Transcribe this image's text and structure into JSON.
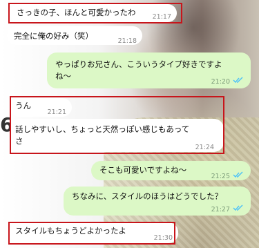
{
  "messages": [
    {
      "side": "left",
      "text": "さっきの子、ほんと可愛かったわ",
      "time": "21:17"
    },
    {
      "side": "left",
      "text": "完全に俺の好み（笑）",
      "time": "21:18"
    },
    {
      "side": "right",
      "lines": [
        "やっぱりお兄さん、こういうタイプ好きですよ",
        "ね〜"
      ],
      "time": "21:20"
    },
    {
      "side": "left",
      "text": "うん",
      "time": "21:21"
    },
    {
      "side": "left",
      "lines": [
        "話しやすいし、ちょっと天然っぽい感じもあって",
        "さ"
      ],
      "time": "21:24"
    },
    {
      "side": "right",
      "text": "そこも可愛いですよね〜",
      "time": "21:25"
    },
    {
      "side": "right",
      "text": "ちなみに、スタイルのほうはどうでした？",
      "time": "21:27"
    },
    {
      "side": "left",
      "text": "スタイルもちょうどよかったよ",
      "time": "21:30"
    }
  ],
  "background_digit": "6",
  "colors": {
    "incoming": "#ffffff",
    "outgoing": "#dcf8c6",
    "highlight": "#c8151b",
    "read_check": "#4fc3f7"
  }
}
